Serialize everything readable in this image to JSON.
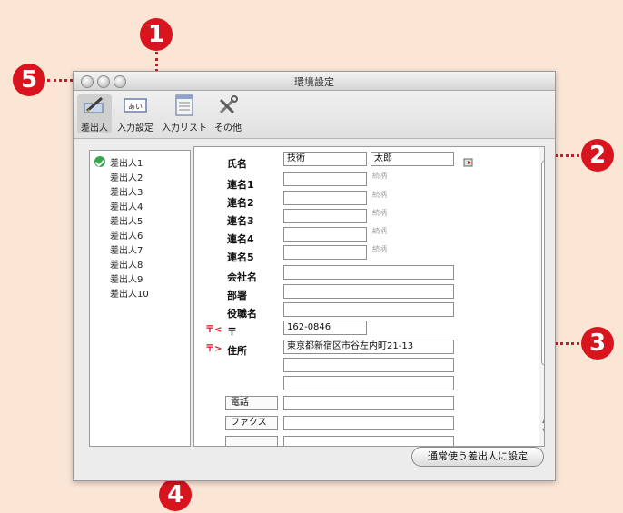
{
  "window": {
    "title": "環境設定"
  },
  "toolbar": {
    "items": [
      {
        "label": "差出人",
        "icon": "pen-icon"
      },
      {
        "label": "入力設定",
        "icon": "input-field-icon"
      },
      {
        "label": "入力リスト",
        "icon": "list-window-icon"
      },
      {
        "label": "その他",
        "icon": "tools-icon"
      }
    ]
  },
  "sender_list": {
    "items": [
      "差出人1",
      "差出人2",
      "差出人3",
      "差出人4",
      "差出人5",
      "差出人6",
      "差出人7",
      "差出人8",
      "差出人9",
      "差出人10"
    ],
    "selected": "差出人1"
  },
  "form": {
    "name_label": "氏名",
    "last_name": "技術",
    "first_name": "太郎",
    "joint_labels": [
      "連名1",
      "連名2",
      "連名3",
      "連名4",
      "連名5"
    ],
    "honorific_hint": "続柄",
    "company_label": "会社名",
    "department_label": "部署",
    "title_label": "役職名",
    "postal_mark_label": "〒",
    "postal_value": "162-0846",
    "address_label": "住所",
    "address_value": "東京都新宿区市谷左内町21-13",
    "phone_label": "電話",
    "fax_label": "ファクス"
  },
  "button": {
    "default_sender": "通常使う差出人に設定"
  },
  "callouts": [
    "1",
    "2",
    "3",
    "4",
    "5"
  ],
  "colors": {
    "callout_red": "#d8141f",
    "page_bg": "#fbe6d6",
    "check_green": "#36a84a"
  }
}
